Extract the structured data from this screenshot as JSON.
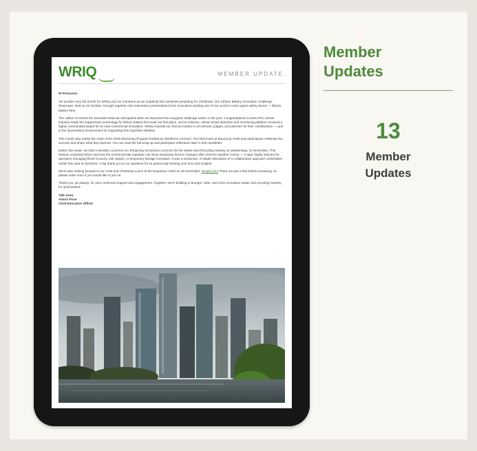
{
  "email": {
    "logo_text": "WRIQ",
    "header_title": "MEMBER UPDATE",
    "greeting": "Hi Everyone,",
    "paragraphs": [
      "Yet another very full month for WRIQ and our members as we suddenly find ourselves preparing for Christmas. Our Lithium Battery Innovation Challenge Showcase, held on 22 October, brought together nine impressive presentations from innovators tackling one of our sector's most urgent safety issues — lithium battery fires.",
      "The calibre of entries far exceeded what we anticipated when we launched this inaugural challenge earlier in the year. Congratulations to ENCAPS, whose industry-ready fire suppression technology for lithium battery fires took out first place, and to Insiemic, whose smart detection and monitoring platform received a highly commended award for its near-commercial innovation. WRIQ extends our sincere thanks to all entrants, judges, and partners for their contributions — and to the Queensland Government for supporting this important initiative.",
      "This month also marks the close of the 2025 Mentoring Program funded by Workforce Connect. The final event at Boonorup Hotel saw participants celebrate the success and share what they learned. You can read the full wrap-up and participant reflections later in this newsletter.",
      "Earlier this week, we held a Member Luncheon on Temporary Emissions Licences for the Waste and Recycling Industry on Wednesday, 12 November. This session unpacked when and how the environmental regulator can issue temporary licence changes after extreme weather events — a topic highly relevant for operators managing flood recovery, site repairs, or temporary storage increases. It was a productive, in-depth discussion of a collaborative approach undertaken earlier this year at Sunshine. A big thank you to our speakers for so generously sharing your time and insights.",
      "We're also looking forward to our AGM and Christmas Lunch at the Emporium Hotel on 28 November.",
      "Thank you, as always, for your continued support and engagement. Together, we're building a stronger, safer, and more innovative waste and recycling industry for Queensland."
    ],
    "link_text": "Details here",
    "link_tail": "There are just a few tickets remaining, so please order soon if you would like to join us.",
    "signoff": [
      "Talk soon,",
      "Alison Price",
      "Chief Executive Officer"
    ]
  },
  "sidebar": {
    "title_line1": "Member",
    "title_line2": "Updates",
    "stat_number": "13",
    "stat_label_line1": "Member",
    "stat_label_line2": "Updates"
  },
  "colors": {
    "accent_green": "#4d8a3c",
    "tablet_bezel": "#161616",
    "panel_bg": "#f8f7f2"
  }
}
